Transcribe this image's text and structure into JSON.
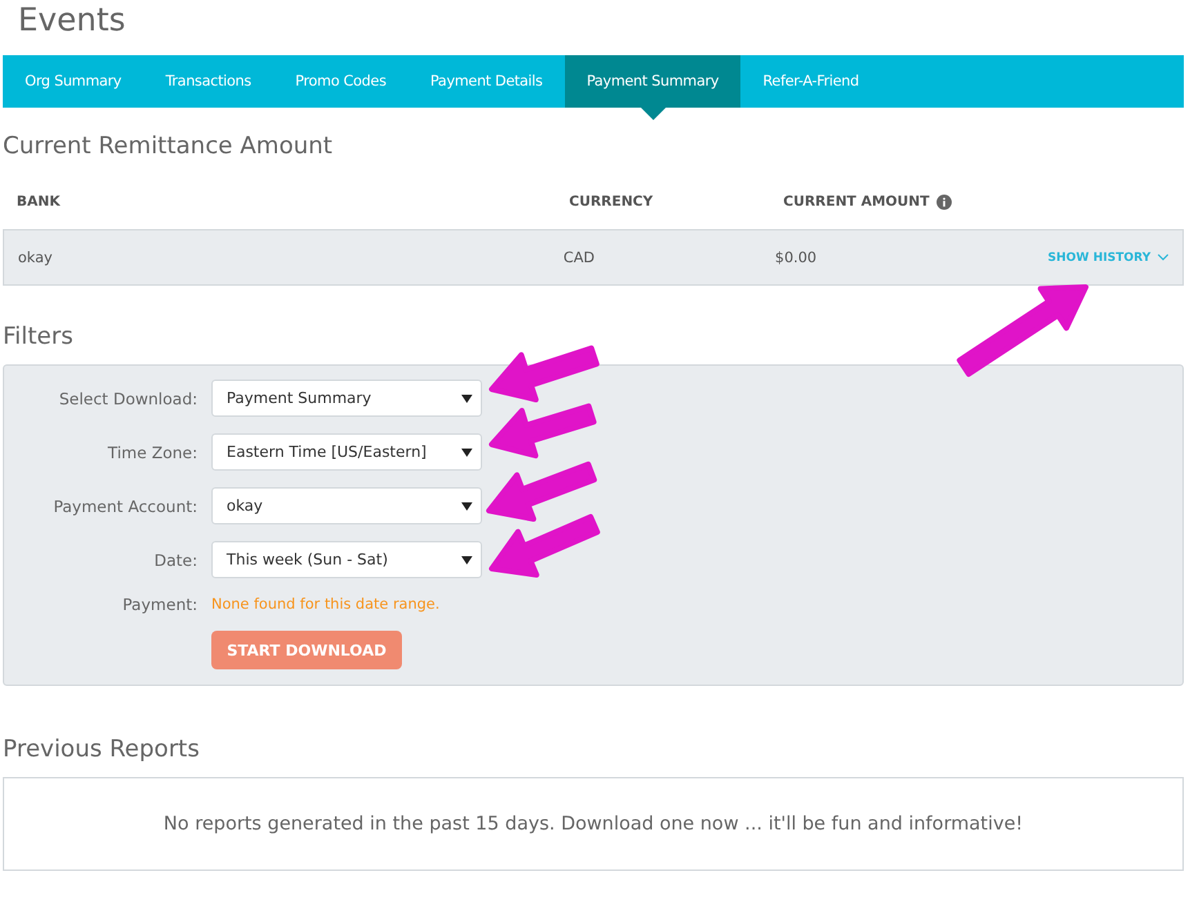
{
  "page_title": "Events",
  "tabs": [
    {
      "label": "Org Summary",
      "selected": false
    },
    {
      "label": "Transactions",
      "selected": false
    },
    {
      "label": "Promo Codes",
      "selected": false
    },
    {
      "label": "Payment Details",
      "selected": false
    },
    {
      "label": "Payment Summary",
      "selected": true
    },
    {
      "label": "Refer-A-Friend",
      "selected": false
    }
  ],
  "remittance": {
    "heading": "Current Remittance Amount",
    "columns": [
      "BANK",
      "CURRENCY",
      "CURRENT AMOUNT"
    ],
    "rows": [
      {
        "cells": [
          "okay",
          "CAD",
          "$0.00"
        ],
        "action": "SHOW HISTORY"
      }
    ]
  },
  "filters": {
    "heading": "Filters",
    "fields": [
      {
        "label": "Select Download:",
        "value": "Payment Summary"
      },
      {
        "label": "Time Zone:",
        "value": "Eastern Time [US/Eastern]"
      },
      {
        "label": "Payment Account:",
        "value": "okay"
      },
      {
        "label": "Date:",
        "value": "This week (Sun - Sat)"
      }
    ],
    "payment_label": "Payment:",
    "payment_message": "None found for this date range.",
    "button": {
      "label": "START DOWNLOAD",
      "disabled": true
    }
  },
  "previous_reports": {
    "heading": "Previous Reports",
    "message": "No reports generated in the past 15 days. Download one now ... it'll be fun and informative!"
  }
}
